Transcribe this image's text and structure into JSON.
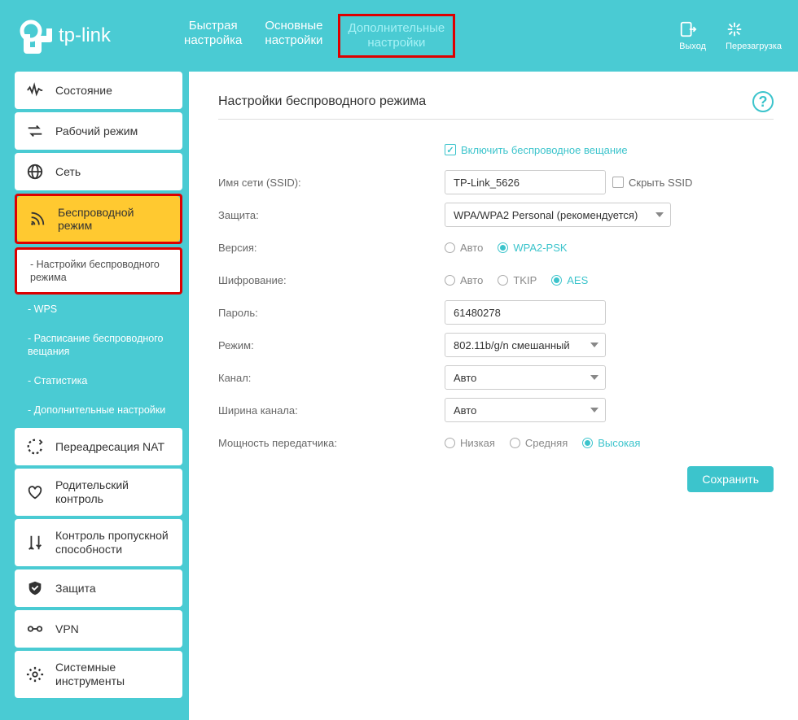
{
  "brand": "tp-link",
  "header": {
    "tabs": [
      {
        "line1": "Быстрая",
        "line2": "настройка"
      },
      {
        "line1": "Основные",
        "line2": "настройки"
      },
      {
        "line1": "Дополнительные",
        "line2": "настройки"
      }
    ],
    "logout": "Выход",
    "reboot": "Перезагрузка"
  },
  "sidebar": {
    "items": [
      {
        "label": "Состояние"
      },
      {
        "label": "Рабочий режим"
      },
      {
        "label": "Сеть"
      },
      {
        "label": "Беспроводной режим"
      },
      {
        "label": "Переадресация NAT"
      },
      {
        "label": "Родительский контроль"
      },
      {
        "label": "Контроль пропускной способности"
      },
      {
        "label": "Защита"
      },
      {
        "label": "VPN"
      },
      {
        "label": "Системные инструменты"
      }
    ],
    "sub": [
      "Настройки беспроводного режима",
      "WPS",
      "Расписание беспроводного вещания",
      "Статистика",
      "Дополнительные настройки"
    ]
  },
  "page": {
    "title": "Настройки беспроводного режима",
    "enable_radio": "Включить беспроводное вещание",
    "ssid_label": "Имя сети (SSID):",
    "ssid_value": "TP-Link_5626",
    "hide_ssid": "Скрыть SSID",
    "security_label": "Защита:",
    "security_value": "WPA/WPA2 Personal (рекомендуется)",
    "version_label": "Версия:",
    "version_opts": [
      "Авто",
      "WPA2-PSK"
    ],
    "encryption_label": "Шифрование:",
    "encryption_opts": [
      "Авто",
      "TKIP",
      "AES"
    ],
    "password_label": "Пароль:",
    "password_value": "61480278",
    "mode_label": "Режим:",
    "mode_value": "802.11b/g/n смешанный",
    "channel_label": "Канал:",
    "channel_value": "Авто",
    "width_label": "Ширина канала:",
    "width_value": "Авто",
    "txpower_label": "Мощность передатчика:",
    "txpower_opts": [
      "Низкая",
      "Средняя",
      "Высокая"
    ],
    "save": "Сохранить"
  }
}
